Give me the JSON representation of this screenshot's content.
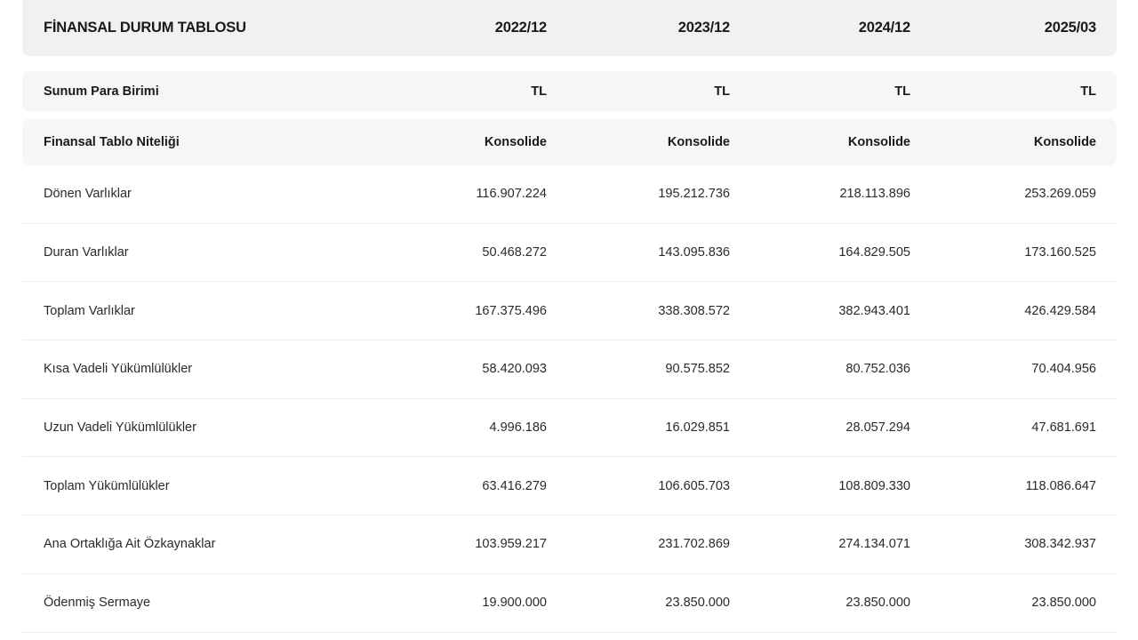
{
  "table": {
    "title": "FİNANSAL DURUM TABLOSU",
    "periods": [
      "2022/12",
      "2023/12",
      "2024/12",
      "2025/03"
    ],
    "meta_rows": [
      {
        "label": "Sunum Para Birimi",
        "values": [
          "TL",
          "TL",
          "TL",
          "TL"
        ]
      },
      {
        "label": "Finansal Tablo Niteliği",
        "values": [
          "Konsolide",
          "Konsolide",
          "Konsolide",
          "Konsolide"
        ]
      }
    ],
    "rows": [
      {
        "label": "Dönen Varlıklar",
        "values": [
          "116.907.224",
          "195.212.736",
          "218.113.896",
          "253.269.059"
        ]
      },
      {
        "label": "Duran Varlıklar",
        "values": [
          "50.468.272",
          "143.095.836",
          "164.829.505",
          "173.160.525"
        ]
      },
      {
        "label": "Toplam Varlıklar",
        "values": [
          "167.375.496",
          "338.308.572",
          "382.943.401",
          "426.429.584"
        ]
      },
      {
        "label": "Kısa Vadeli Yükümlülükler",
        "values": [
          "58.420.093",
          "90.575.852",
          "80.752.036",
          "70.404.956"
        ]
      },
      {
        "label": "Uzun Vadeli Yükümlülükler",
        "values": [
          "4.996.186",
          "16.029.851",
          "28.057.294",
          "47.681.691"
        ]
      },
      {
        "label": "Toplam Yükümlülükler",
        "values": [
          "63.416.279",
          "106.605.703",
          "108.809.330",
          "118.086.647"
        ]
      },
      {
        "label": "Ana Ortaklığa Ait Özkaynaklar",
        "values": [
          "103.959.217",
          "231.702.869",
          "274.134.071",
          "308.342.937"
        ]
      },
      {
        "label": "Ödenmiş Sermaye",
        "values": [
          "19.900.000",
          "23.850.000",
          "23.850.000",
          "23.850.000"
        ]
      }
    ]
  }
}
